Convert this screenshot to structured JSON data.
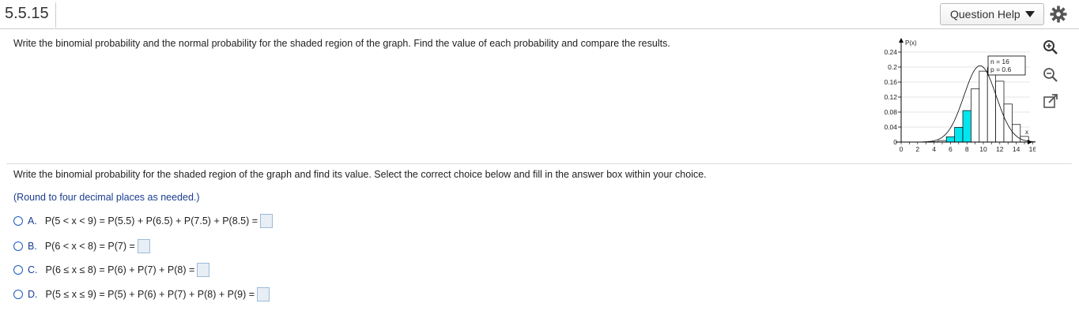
{
  "header": {
    "problem_number": "5.5.15",
    "question_help_label": "Question Help",
    "settings_icon": "gear-icon"
  },
  "prompt": "Write the binomial probability and the normal probability for the shaded region of the graph. Find the value of each probability and compare the results.",
  "graph": {
    "y_axis_label": "P(x)",
    "x_axis_label": "x",
    "legend_n": "n = 16",
    "legend_p": "p = 0.6",
    "y_ticks": [
      "0.24",
      "0.2",
      "0.16",
      "0.12",
      "0.08",
      "0.04",
      "0"
    ],
    "x_ticks": [
      "0",
      "2",
      "4",
      "6",
      "8",
      "10",
      "12",
      "14",
      "16"
    ],
    "colors": {
      "shaded": "#00e5ee",
      "bar_border": "#000000",
      "grid": "#cccccc"
    }
  },
  "chart_data": {
    "type": "bar",
    "categories": [
      "0",
      "1",
      "2",
      "3",
      "4",
      "5",
      "6",
      "7",
      "8",
      "9",
      "10",
      "11",
      "12",
      "13",
      "14",
      "15",
      "16"
    ],
    "values": [
      0.0,
      0.0,
      0.0,
      0.0001,
      0.0008,
      0.004,
      0.0142,
      0.0392,
      0.084,
      0.1417,
      0.1892,
      0.1985,
      0.1623,
      0.1014,
      0.0468,
      0.015,
      0.0003
    ],
    "shaded": [
      6,
      7,
      8
    ],
    "xlabel": "x",
    "ylabel": "P(x)",
    "xlim": [
      0,
      16
    ],
    "ylim": [
      0,
      0.24
    ],
    "y_ticks": [
      0,
      0.04,
      0.08,
      0.12,
      0.16,
      0.2,
      0.24
    ],
    "x_ticks": [
      0,
      2,
      4,
      6,
      8,
      10,
      12,
      14,
      16
    ],
    "grid": true,
    "legend": [
      "n = 16",
      "p = 0.6"
    ]
  },
  "tools": {
    "zoom_in": "zoom-in-icon",
    "zoom_out": "zoom-out-icon",
    "popout": "popout-icon"
  },
  "subprompt": "Write the binomial probability for the shaded region of the graph and find its value. Select the correct choice below and fill in the answer box within your choice.",
  "round_note": "(Round to four decimal places as needed.)",
  "choices": [
    {
      "letter": "A.",
      "text": "P(5 < x < 9) = P(5.5) + P(6.5) + P(7.5) + P(8.5) ="
    },
    {
      "letter": "B.",
      "text": "P(6 < x < 8) = P(7) ="
    },
    {
      "letter": "C.",
      "text": "P(6 ≤ x ≤ 8) = P(6) + P(7) + P(8) ="
    },
    {
      "letter": "D.",
      "text": "P(5 ≤ x ≤ 9) = P(5) + P(6) + P(7) + P(8) + P(9) ="
    }
  ]
}
